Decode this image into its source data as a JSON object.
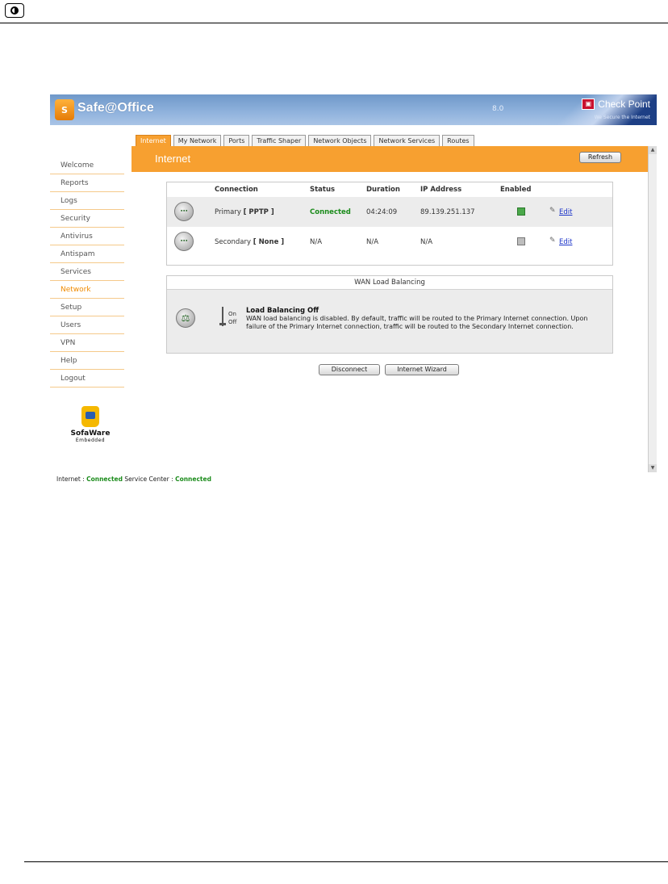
{
  "app": {
    "brand": "Safe@Office",
    "version": "8.0",
    "vendor": "Check Point",
    "vendor_tagline": "We Secure the Internet",
    "logo_letter": "S"
  },
  "nav": {
    "items": [
      "Welcome",
      "Reports",
      "Logs",
      "Security",
      "Antivirus",
      "Antispam",
      "Services",
      "Network",
      "Setup",
      "Users",
      "VPN",
      "Help",
      "Logout"
    ],
    "active": "Network"
  },
  "sofaware": {
    "name": "SofaWare",
    "sub": "Embedded"
  },
  "tabs": [
    "Internet",
    "My Network",
    "Ports",
    "Traffic Shaper",
    "Network Objects",
    "Network Services",
    "Routes"
  ],
  "page": {
    "title": "Internet",
    "refresh_label": "Refresh"
  },
  "connections": {
    "headers": {
      "connection": "Connection",
      "status": "Status",
      "duration": "Duration",
      "ip": "IP Address",
      "enabled": "Enabled"
    },
    "rows": [
      {
        "name": "Primary",
        "type": "[ PPTP ]",
        "status": "Connected",
        "duration": "04:24:09",
        "ip": "89.139.251.137",
        "enabled": true,
        "edit": "Edit"
      },
      {
        "name": "Secondary",
        "type": "[ None ]",
        "status": "N/A",
        "duration": "N/A",
        "ip": "N/A",
        "enabled": false,
        "edit": "Edit"
      }
    ]
  },
  "wan": {
    "header": "WAN Load Balancing",
    "switch_on": "On",
    "switch_off": "Off",
    "title": "Load Balancing Off",
    "description": "WAN load balancing is disabled. By default, traffic will be routed to the Primary Internet connection. Upon failure of the Primary Internet connection, traffic will be routed to the Secondary Internet connection."
  },
  "actions": {
    "disconnect": "Disconnect",
    "wizard": "Internet Wizard"
  },
  "status_bar": {
    "internet_label": "Internet :",
    "internet_value": "Connected",
    "service_label": "Service Center :",
    "service_value": "Connected"
  },
  "colors": {
    "accent": "#f7a030",
    "header_blue": "#8eb1dc",
    "ok_green": "#1c8c1c",
    "link_blue": "#1c35c9"
  }
}
